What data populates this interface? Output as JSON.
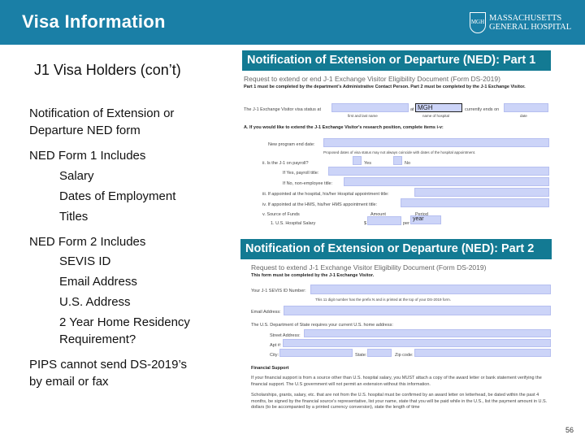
{
  "header": {
    "title": "Visa Information",
    "logo_line1": "MASSACHUSETTS",
    "logo_line2": "GENERAL HOSPITAL",
    "logo_shield": "MGH"
  },
  "subtitle": "J1 Visa Holders (con’t)",
  "left": {
    "ned_form_line1": "Notification of Extension or",
    "ned_form_line2": "Departure NED form",
    "form1_heading": "NED Form 1 Includes",
    "form1_items": [
      "Salary",
      "Dates of Employment",
      "Titles"
    ],
    "form2_heading": "NED Form 2 Includes",
    "form2_items": [
      "SEVIS ID",
      "Email Address",
      "U.S. Address",
      "2 Year Home Residency",
      "Requirement?"
    ],
    "pips_line1": "PIPS cannot send DS-2019’s",
    "pips_line2": "by email or fax"
  },
  "part1": {
    "title": "Notification of Extension or Departure (NED): Part 1",
    "request": "Request to extend or end J-1 Exchange Visitor Eligibility Document (Form DS-2019)",
    "instr": "Part 1 must be completed by the department’s Administrative Contact Person. Part 2 must be completed by the J-1 Exchange Visitor.",
    "status_label": "The J-1 Exchange Visitor visa status at",
    "at": "at",
    "hospital_value": "MGH",
    "ends": "currently ends on",
    "cap_name": "first and last name",
    "cap_hosp": "name of hospital",
    "cap_date": "date",
    "section_a": "A. If you would like to extend the J-1 Exchange Visitor's research position, complete items i-v:",
    "new_end": "New program end date:",
    "note": "Proposed dates of visa status may not always coincide with dates of the hospital appointment.",
    "payroll": "ii. Is the J-1 on payroll?",
    "yes": "Yes",
    "no": "No",
    "payroll_title": "If Yes, payroll title:",
    "nonemp": "If No, non-employee title:",
    "hosp_title": "iii. If appointed at the hospital, his/her Hospital appointment title:",
    "hms_title": "iv. If appointed at the HMS, his/her HMS appointment title:",
    "funds": "v. Source of Funds",
    "amount": "Amount",
    "period": "Period",
    "salary": "1. U.S. Hospital Salary",
    "dollar": "$",
    "per": "per",
    "period_value": "year"
  },
  "part2": {
    "title": "Notification of Extension or Departure (NED): Part 2",
    "request": "Request to extend J-1 Exchange Visitor Eligibility Document (Form DS-2019)",
    "instr": "This form must be completed by the J-1 Exchange Visitor.",
    "sevis": "Your J-1 SEVIS ID Number:",
    "sevis_note": "This 11 digit number has the prefix N and is printed at the top of your DS-2019 form.",
    "email": "Email Address:",
    "dos": "The U.S. Department of State requires your current U.S. home address:",
    "street": "Street Address:",
    "apt": "Apt #:",
    "city": "City:",
    "state": "State:",
    "zip": "Zip code:",
    "fin": "Financial Support",
    "fin_p1": "If your financial support is from a source other than U.S. hospital salary, you MUST attach a copy of the award letter or bank statement verifying the financial support. The U.S government will not permit an extension without this information.",
    "fin_p2": "Scholarships, grants, salary, etc. that are not from the U.S. hospital must be confirmed by an award letter on letterhead, be dated within the past 4 months, be signed by the financial source's representative, list your name, state that you will be paid while in the U.S., list the payment amount in U.S. dollars (to be accompanied by a printed currency conversion), state the length of time"
  },
  "page_number": "56"
}
